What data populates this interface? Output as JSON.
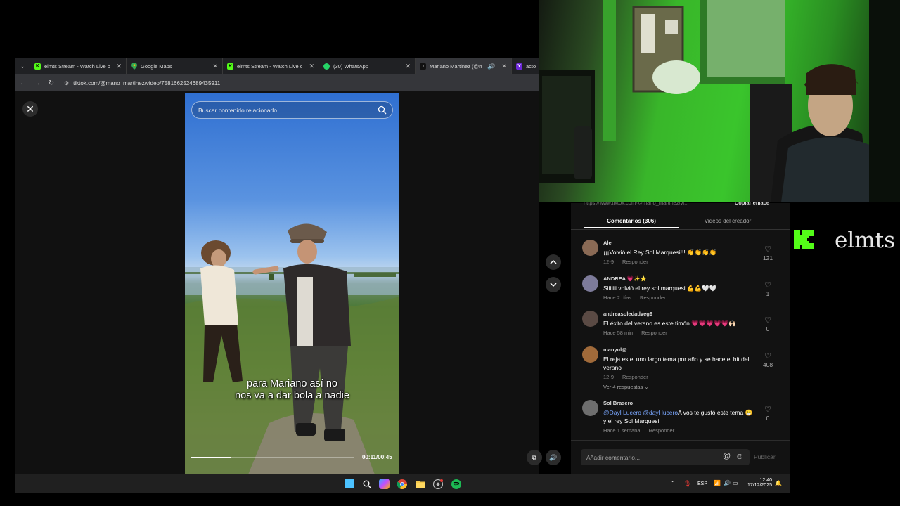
{
  "browser": {
    "tabs": [
      {
        "title": "elmts Stream - Watch Live on K",
        "favicon_color": "#53fc18",
        "favicon_letter": "K"
      },
      {
        "title": "Google Maps",
        "favicon_color": "#34a853",
        "favicon_letter": ""
      },
      {
        "title": "elmts Stream - Watch Live on K",
        "favicon_color": "#53fc18",
        "favicon_letter": "K"
      },
      {
        "title": "(30) WhatsApp",
        "favicon_color": "#25d366",
        "favicon_letter": ""
      },
      {
        "title": "Mariano Martinez (@mano",
        "favicon_color": "#111111",
        "favicon_letter": "♪",
        "active": true
      },
      {
        "title": "actor a",
        "favicon_color": "#6d28d9",
        "favicon_letter": "Y"
      }
    ],
    "url": "tiktok.com/@mano_martinez/video/7581662524689435911"
  },
  "video": {
    "search_placeholder": "Buscar contenido relacionado",
    "subtitle_line1": "para Mariano así no",
    "subtitle_line2": "nos va a dar bola a nadie",
    "timecode": "00:11/00:45",
    "progress": 0.244
  },
  "comments_panel": {
    "copy_link_url": "https://www.tiktok.com/@mano_martinez/vi...",
    "copy_link_label": "Copiar enlace",
    "tab_comments": "Comentarios (306)",
    "tab_creator": "Videos del creador",
    "reply_label": "Responder",
    "comments": [
      {
        "user": "Ale",
        "text": "¡¡¡Volvió el Rey Sol Marquesi!!! 👏👏👏👏",
        "time": "12-9",
        "likes": "121",
        "avatar_color": "#8a6a55"
      },
      {
        "user": "ANDREA 💗✨⭐",
        "text": "Siiiiiii volvió el rey sol marquesi 💪💪🤍🤍",
        "time": "Hace 2 días",
        "likes": "1",
        "avatar_color": "#7d7b9a"
      },
      {
        "user": "andreasoledadveg9",
        "text": "El éxito del verano es este timón 💗💗💗💗💗🙌🏻",
        "time": "Hace 58 min",
        "likes": "0",
        "avatar_color": "#5a4a44"
      },
      {
        "user": "manyul@",
        "text": "El reja es el uno largo tema por año y se hace el hit del verano",
        "time": "12-9",
        "likes": "408",
        "avatar_color": "#a06a3a"
      },
      {
        "user": "Sol Brasero",
        "mention": "@Dayl Lucero @dayl lucero",
        "text": "A vos te gustó este tema 😁 y el rey Sol Marquesi",
        "time": "Hace 1 semana",
        "likes": "0",
        "avatar_color": "#6e6e6e"
      }
    ],
    "view_replies": "Ver 4 respuestas ⌄",
    "input_placeholder": "Añadir comentario...",
    "publish_label": "Publicar"
  },
  "overlay": {
    "brand_text": "elmts",
    "brand_color": "#53fc18"
  },
  "taskbar": {
    "language": "ESP",
    "time": "12:40",
    "date": "17/12/2025"
  }
}
